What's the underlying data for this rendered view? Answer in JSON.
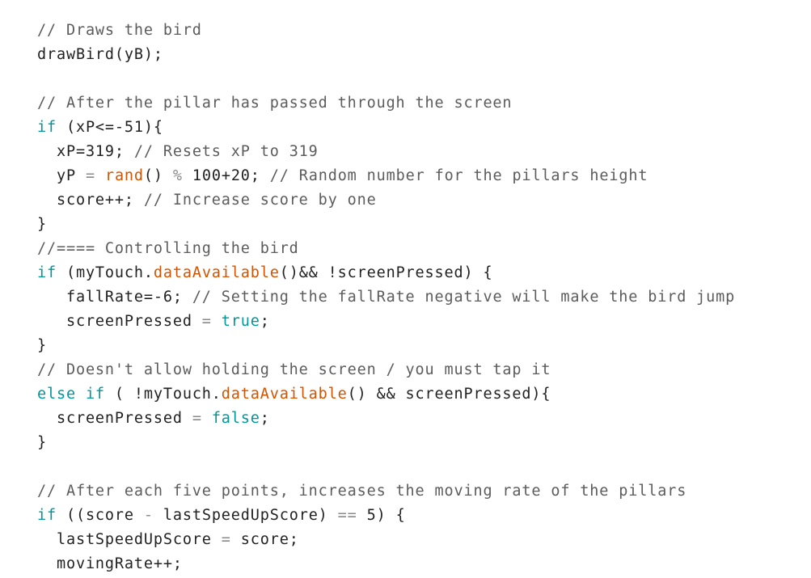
{
  "colors": {
    "keyword": "#00979c",
    "function": "#d35400",
    "comment": "#5c5c5c",
    "text": "#222222",
    "background": "#ffffff"
  },
  "code": {
    "lines": [
      [
        {
          "t": "comment",
          "v": "// Draws the bird"
        }
      ],
      [
        {
          "t": "text",
          "v": "drawBird(yB);"
        }
      ],
      [],
      [
        {
          "t": "comment",
          "v": "// After the pillar has passed through the screen"
        }
      ],
      [
        {
          "t": "keyword",
          "v": "if"
        },
        {
          "t": "text",
          "v": " (xP<=-51){"
        }
      ],
      [
        {
          "t": "text",
          "v": "  xP=319; "
        },
        {
          "t": "comment",
          "v": "// Resets xP to 319"
        }
      ],
      [
        {
          "t": "text",
          "v": "  yP "
        },
        {
          "t": "op",
          "v": "="
        },
        {
          "t": "text",
          "v": " "
        },
        {
          "t": "func",
          "v": "rand"
        },
        {
          "t": "text",
          "v": "() "
        },
        {
          "t": "op",
          "v": "%"
        },
        {
          "t": "text",
          "v": " 100+20; "
        },
        {
          "t": "comment",
          "v": "// Random number for the pillars height"
        }
      ],
      [
        {
          "t": "text",
          "v": "  score++; "
        },
        {
          "t": "comment",
          "v": "// Increase score by one"
        }
      ],
      [
        {
          "t": "text",
          "v": "}"
        }
      ],
      [
        {
          "t": "comment",
          "v": "//==== Controlling the bird"
        }
      ],
      [
        {
          "t": "keyword",
          "v": "if"
        },
        {
          "t": "text",
          "v": " (myTouch."
        },
        {
          "t": "func",
          "v": "dataAvailable"
        },
        {
          "t": "text",
          "v": "()&& !screenPressed) {"
        }
      ],
      [
        {
          "t": "text",
          "v": "   fallRate=-6; "
        },
        {
          "t": "comment",
          "v": "// Setting the fallRate negative will make the bird jump"
        }
      ],
      [
        {
          "t": "text",
          "v": "   screenPressed "
        },
        {
          "t": "op",
          "v": "="
        },
        {
          "t": "text",
          "v": " "
        },
        {
          "t": "keyword",
          "v": "true"
        },
        {
          "t": "text",
          "v": ";"
        }
      ],
      [
        {
          "t": "text",
          "v": "}"
        }
      ],
      [
        {
          "t": "comment",
          "v": "// Doesn't allow holding the screen / you must tap it"
        }
      ],
      [
        {
          "t": "keyword",
          "v": "else if"
        },
        {
          "t": "text",
          "v": " ( !myTouch."
        },
        {
          "t": "func",
          "v": "dataAvailable"
        },
        {
          "t": "text",
          "v": "() && screenPressed){"
        }
      ],
      [
        {
          "t": "text",
          "v": "  screenPressed "
        },
        {
          "t": "op",
          "v": "="
        },
        {
          "t": "text",
          "v": " "
        },
        {
          "t": "keyword",
          "v": "false"
        },
        {
          "t": "text",
          "v": ";"
        }
      ],
      [
        {
          "t": "text",
          "v": "}"
        }
      ],
      [],
      [
        {
          "t": "comment",
          "v": "// After each five points, increases the moving rate of the pillars"
        }
      ],
      [
        {
          "t": "keyword",
          "v": "if"
        },
        {
          "t": "text",
          "v": " ((score "
        },
        {
          "t": "op",
          "v": "-"
        },
        {
          "t": "text",
          "v": " lastSpeedUpScore) "
        },
        {
          "t": "op",
          "v": "=="
        },
        {
          "t": "text",
          "v": " 5) {"
        }
      ],
      [
        {
          "t": "text",
          "v": "  lastSpeedUpScore "
        },
        {
          "t": "op",
          "v": "="
        },
        {
          "t": "text",
          "v": " score;"
        }
      ],
      [
        {
          "t": "text",
          "v": "  movingRate++;"
        }
      ]
    ]
  }
}
